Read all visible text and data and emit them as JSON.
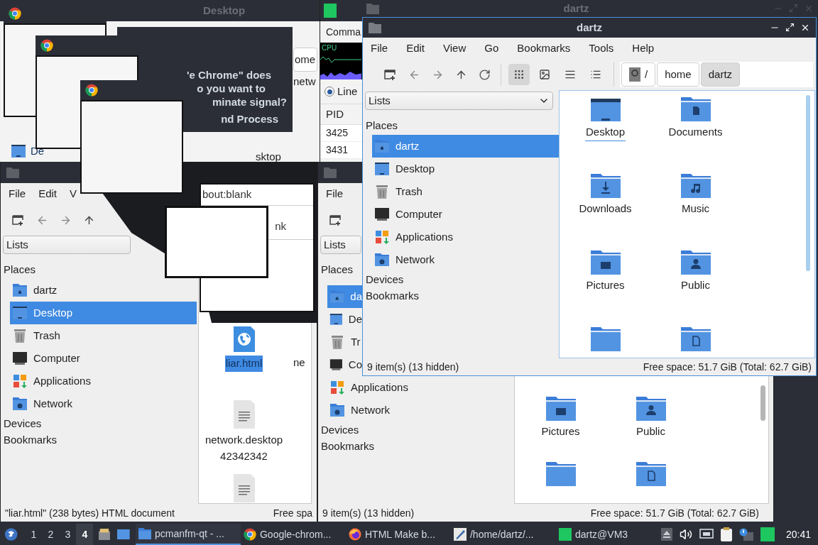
{
  "desktop_window": {
    "title": "Desktop",
    "button": "ome",
    "text_fragment": "netw",
    "icon_label": "De",
    "bottom_fragment": "sktop"
  },
  "kill_dialog": {
    "lines": [
      "'e Chrome\" does",
      "o you want to",
      "minate signal?",
      "nd Process"
    ]
  },
  "task_manager": {
    "header": "Comma",
    "graph_label": "CPU",
    "radio": {
      "label": "Line",
      "selected": true
    },
    "column": "PID",
    "rows": [
      "3425",
      "3431"
    ]
  },
  "chrome_ghost": {
    "tab": "bout:blank",
    "tab_fragment": "nk"
  },
  "left_window": {
    "menu": [
      "File",
      "Edit",
      "V"
    ],
    "combo": "Lists",
    "places_heading": "Places",
    "places": [
      {
        "label": "dartz",
        "kind": "home",
        "selected": false
      },
      {
        "label": "Desktop",
        "kind": "desktop",
        "selected": true
      },
      {
        "label": "Trash",
        "kind": "trash",
        "selected": false
      },
      {
        "label": "Computer",
        "kind": "computer",
        "selected": false
      },
      {
        "label": "Applications",
        "kind": "apps",
        "selected": false
      },
      {
        "label": "Network",
        "kind": "network",
        "selected": false
      }
    ],
    "sections": [
      "Devices",
      "Bookmarks"
    ],
    "files": [
      {
        "name": "liar.html",
        "kind": "web",
        "selected": true
      },
      {
        "name": "network.desktop\n42342342",
        "kind": "text",
        "selected": false
      },
      {
        "kind": "text"
      }
    ],
    "name_fragment": "ne",
    "status_left": "\"liar.html\" (238 bytes) HTML document",
    "status_right": "Free spa"
  },
  "middle_window": {
    "menu": [
      "File"
    ],
    "combo": "Lists",
    "places_heading": "Places",
    "places": [
      {
        "label": "da",
        "kind": "home",
        "selected": true
      },
      {
        "label": "De",
        "kind": "desktop",
        "selected": false
      },
      {
        "label": "Tr",
        "kind": "trash",
        "selected": false
      },
      {
        "label": "Co",
        "kind": "computer",
        "selected": false
      },
      {
        "label": "Applications",
        "kind": "apps",
        "selected": false
      },
      {
        "label": "Network",
        "kind": "network",
        "selected": false
      }
    ],
    "sections": [
      "Devices",
      "Bookmarks"
    ],
    "files": [
      {
        "name": "Pictures",
        "kind": "pictures"
      },
      {
        "name": "Public",
        "kind": "public"
      },
      {
        "kind": "plain"
      },
      {
        "kind": "file"
      }
    ],
    "status_left": "9 item(s) (13 hidden)",
    "status_right": "Free space: 51.7 GiB (Total: 62.7 GiB)"
  },
  "back_window": {
    "title": "dartz"
  },
  "main_window": {
    "title": "dartz",
    "menu": [
      "File",
      "Edit",
      "View",
      "Go",
      "Bookmarks",
      "Tools",
      "Help"
    ],
    "path": [
      {
        "label": "/",
        "kind": "root",
        "selected": false
      },
      {
        "label": "home",
        "kind": "dir",
        "selected": false
      },
      {
        "label": "dartz",
        "kind": "dir",
        "selected": true
      }
    ],
    "combo": "Lists",
    "places_heading": "Places",
    "places": [
      {
        "label": "dartz",
        "kind": "home",
        "selected": true
      },
      {
        "label": "Desktop",
        "kind": "desktop",
        "selected": false
      },
      {
        "label": "Trash",
        "kind": "trash",
        "selected": false
      },
      {
        "label": "Computer",
        "kind": "computer",
        "selected": false
      },
      {
        "label": "Applications",
        "kind": "apps",
        "selected": false
      },
      {
        "label": "Network",
        "kind": "network",
        "selected": false
      }
    ],
    "sections": [
      "Devices",
      "Bookmarks"
    ],
    "files": [
      {
        "name": "Desktop",
        "kind": "desktop",
        "focused": true
      },
      {
        "name": "Documents",
        "kind": "documents",
        "focused": false
      },
      {
        "name": "Downloads",
        "kind": "downloads",
        "focused": false
      },
      {
        "name": "Music",
        "kind": "music",
        "focused": false
      },
      {
        "name": "Pictures",
        "kind": "pictures",
        "focused": false
      },
      {
        "name": "Public",
        "kind": "public",
        "focused": false
      },
      {
        "kind": "plain"
      },
      {
        "kind": "file"
      }
    ],
    "status_left": "9 item(s) (13 hidden)",
    "status_right": "Free space: 51.7 GiB (Total: 62.7 GiB)"
  },
  "taskbar": {
    "workspaces": [
      {
        "label": "1",
        "selected": false
      },
      {
        "label": "2",
        "selected": false
      },
      {
        "label": "3",
        "selected": false
      },
      {
        "label": "4",
        "selected": true
      }
    ],
    "tasks": [
      {
        "label": "pcmanfm-qt - ...",
        "kind": "folder",
        "selected": true
      },
      {
        "label": "Google-chrom...",
        "kind": "chrome",
        "selected": false
      },
      {
        "label": "HTML Make b...",
        "kind": "firefox",
        "selected": false
      },
      {
        "label": "/home/dartz/...",
        "kind": "editor",
        "selected": false
      },
      {
        "label": "dartz@VM3",
        "kind": "terminal",
        "selected": false
      }
    ],
    "clock": "20:41"
  }
}
